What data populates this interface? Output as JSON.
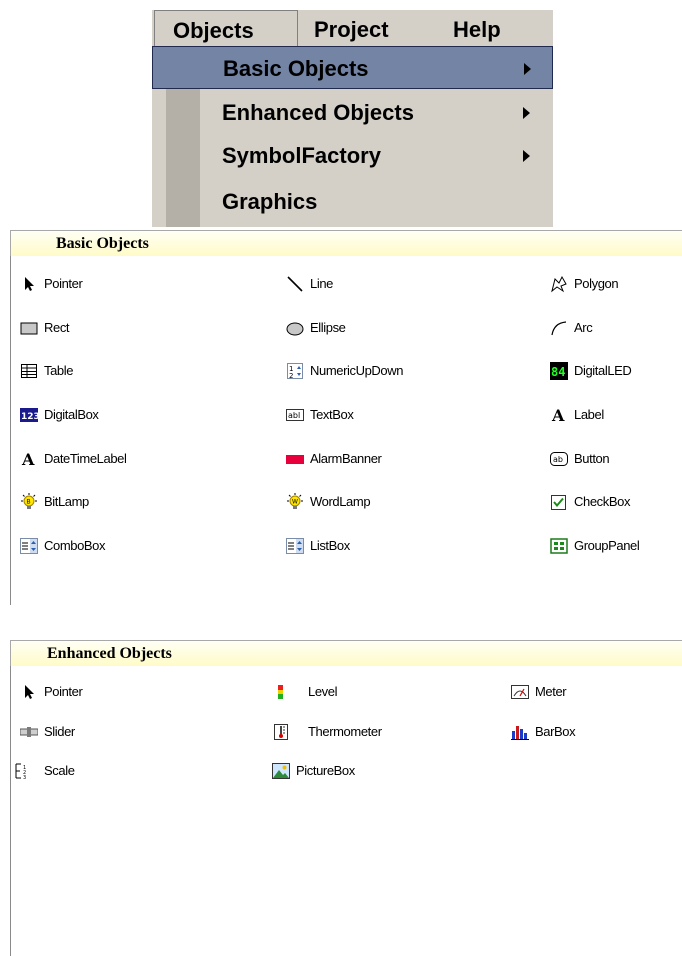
{
  "menubar": {
    "items": [
      "Objects",
      "Project",
      "Help"
    ]
  },
  "dropdown": {
    "items": [
      {
        "label": "Basic Objects",
        "submenu": true
      },
      {
        "label": "Enhanced Objects",
        "submenu": true
      },
      {
        "label": "SymbolFactory",
        "submenu": true
      },
      {
        "label": "Graphics",
        "submenu": false
      }
    ]
  },
  "basic": {
    "title": "Basic Objects",
    "tools": [
      "Pointer",
      "Line",
      "Polygon",
      "Rect",
      "Ellipse",
      "Arc",
      "Table",
      "NumericUpDown",
      "DigitalLED",
      "DigitalBox",
      "TextBox",
      "Label",
      "DateTimeLabel",
      "AlarmBanner",
      "Button",
      "BitLamp",
      "WordLamp",
      "CheckBox",
      "ComboBox",
      "ListBox",
      "GroupPanel"
    ]
  },
  "enhanced": {
    "title": "Enhanced Objects",
    "tools": [
      "Pointer",
      "Level",
      "Meter",
      "Slider",
      "Thermometer",
      "BarBox",
      "Scale",
      "PictureBox"
    ]
  },
  "colors": {
    "menu_bg": "#d4d0c8",
    "menu_selected": "#7384a5",
    "panel_header": "#fffbc8"
  }
}
